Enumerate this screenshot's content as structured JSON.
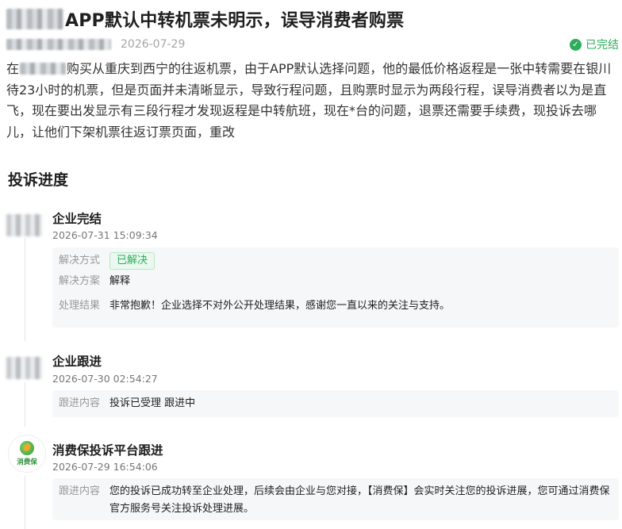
{
  "header": {
    "title": "APP默认中转机票未明示，误导消费者购票",
    "date": "2026-07-29",
    "status": "已完结"
  },
  "description": {
    "part1": "在",
    "part2": "购买从重庆到西宁的往返机票，由于APP默认选择问题，他的最低价格返程是一张中转需要在银川待23小时的机票，但是页面并未清晰显示，导致行程问题，且购票时显示为两段行程，误导消费者以为是直飞，现在要出发显示有三段行程才发现返程是中转航班，现在*台的问题，退票还需要手续费，现投诉去哪儿，让他们下架机票往返订票页面，重改"
  },
  "progress": {
    "section_title": "投诉进度",
    "entries": [
      {
        "title": "企业完结",
        "time": "2026-07-31 15:09:34",
        "fields": [
          {
            "label": "解决方式",
            "value": "已解决"
          },
          {
            "label": "解决方案",
            "value": "解释"
          },
          {
            "label": "处理结果",
            "value": "非常抱歉！企业选择不对外公开处理结果，感谢您一直以来的关注与支持。"
          }
        ]
      },
      {
        "title": "企业跟进",
        "time": "2026-07-30 02:54:27",
        "fields": [
          {
            "label": "跟进内容",
            "value": "投诉已受理 跟进中"
          }
        ]
      },
      {
        "title": "消费保投诉平台跟进",
        "time": "2026-07-29 16:54:06",
        "logo_text": "消费保",
        "fields": [
          {
            "label": "跟进内容",
            "value": "您的投诉已成功转至企业处理，后续会由企业与您对接，【消费保】会实时关注您的投诉进展，您可通过消费保官方服务号关注投诉处理进展。"
          }
        ]
      }
    ]
  },
  "colors": {
    "accent_green": "#2dae5c",
    "card_bg": "#f6f7f8"
  },
  "icons": {
    "status": "check-circle-icon"
  }
}
